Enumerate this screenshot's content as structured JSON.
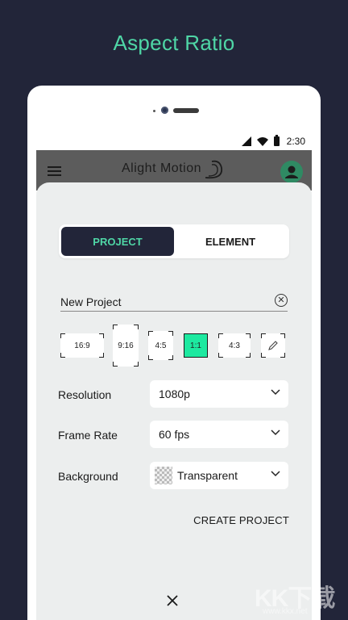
{
  "headline": "Aspect Ratio",
  "status": {
    "time": "2:30",
    "icons": [
      "signal-icon",
      "wifi-icon",
      "battery-icon"
    ]
  },
  "appbar": {
    "logo_text": "Alight Motion",
    "menu_icon": "hamburger-menu-icon",
    "avatar_icon": "account-icon"
  },
  "tabs": [
    {
      "label": "PROJECT",
      "active": true
    },
    {
      "label": "ELEMENT",
      "active": false
    }
  ],
  "project_name": {
    "value": "New Project",
    "clear_icon": "close-circle-icon"
  },
  "aspect_ratios": [
    {
      "label": "16:9",
      "selected": false
    },
    {
      "label": "9:16",
      "selected": false
    },
    {
      "label": "4:5",
      "selected": false
    },
    {
      "label": "1:1",
      "selected": true
    },
    {
      "label": "4:3",
      "selected": false
    }
  ],
  "custom_ratio_icon": "pencil-icon",
  "settings": {
    "resolution": {
      "label": "Resolution",
      "value": "1080p"
    },
    "frame_rate": {
      "label": "Frame Rate",
      "value": "60 fps"
    },
    "background": {
      "label": "Background",
      "value": "Transparent"
    }
  },
  "create_button": "CREATE PROJECT",
  "close_icon": "close-icon",
  "watermark": {
    "text": "KK下载",
    "url": "www.kkx.net"
  },
  "colors": {
    "accent": "#4fd6a6",
    "dark": "#222539",
    "selected_ratio": "#1de9a0"
  }
}
